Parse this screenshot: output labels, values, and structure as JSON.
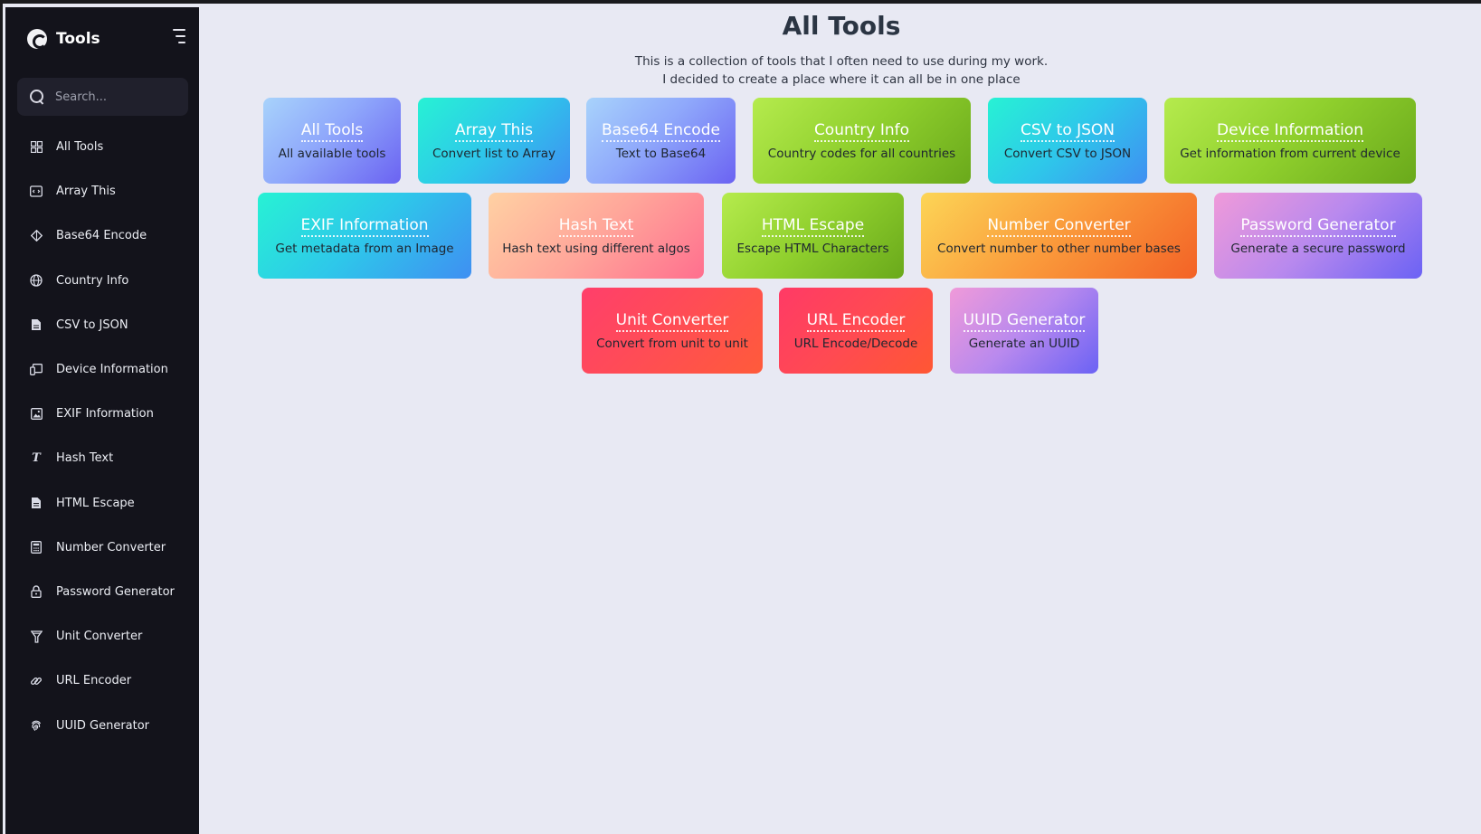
{
  "sidebar": {
    "brand_title": "Tools",
    "search_placeholder": "Search...",
    "items": [
      {
        "label": "All Tools",
        "icon": "grid-icon"
      },
      {
        "label": "Array This",
        "icon": "code-icon"
      },
      {
        "label": "Base64 Encode",
        "icon": "diamond-icon"
      },
      {
        "label": "Country Info",
        "icon": "globe-icon"
      },
      {
        "label": "CSV to JSON",
        "icon": "file-icon"
      },
      {
        "label": "Device Information",
        "icon": "devices-icon"
      },
      {
        "label": "EXIF Information",
        "icon": "image-icon"
      },
      {
        "label": "Hash Text",
        "icon": "italic-t-icon"
      },
      {
        "label": "HTML Escape",
        "icon": "file-text-icon"
      },
      {
        "label": "Number Converter",
        "icon": "calculator-icon"
      },
      {
        "label": "Password Generator",
        "icon": "lock-icon"
      },
      {
        "label": "Unit Converter",
        "icon": "filter-icon"
      },
      {
        "label": "URL Encoder",
        "icon": "link-icon"
      },
      {
        "label": "UUID Generator",
        "icon": "fingerprint-icon"
      }
    ]
  },
  "main": {
    "title": "All Tools",
    "intro_line1": "This is a collection of tools that I often need to use during my work.",
    "intro_line2": "I decided to create a place where it can all be in one place",
    "cards": [
      {
        "title": "All Tools",
        "desc": "All available tools",
        "accent": "#8fa8fb"
      },
      {
        "title": "Array This",
        "desc": "Convert list to Array",
        "accent": "#2ec7ea"
      },
      {
        "title": "Base64 Encode",
        "desc": "Text to Base64",
        "accent": "#8fa8fb"
      },
      {
        "title": "Country Info",
        "desc": "Country codes for all countries",
        "accent": "#8fcf2d"
      },
      {
        "title": "CSV to JSON",
        "desc": "Convert CSV to JSON",
        "accent": "#2ec7ea"
      },
      {
        "title": "Device Information",
        "desc": "Get information from current device",
        "accent": "#8fcf2d"
      },
      {
        "title": "EXIF Information",
        "desc": "Get metadata from an Image",
        "accent": "#2ec7ea"
      },
      {
        "title": "Hash Text",
        "desc": "Hash text using different algos",
        "accent": "#ffa69a"
      },
      {
        "title": "HTML Escape",
        "desc": "Escape HTML Characters",
        "accent": "#8fcf2d"
      },
      {
        "title": "Number Converter",
        "desc": "Convert number to other number bases",
        "accent": "#fa9a3b"
      },
      {
        "title": "Password Generator",
        "desc": "Generate a secure password",
        "accent": "#b889ee"
      },
      {
        "title": "Unit Converter",
        "desc": "Convert from unit to unit",
        "accent": "#ff4d54"
      },
      {
        "title": "URL Encoder",
        "desc": "URL Encode/Decode",
        "accent": "#ff4a52"
      },
      {
        "title": "UUID Generator",
        "desc": "Generate an UUID",
        "accent": "#b889ee"
      }
    ]
  }
}
